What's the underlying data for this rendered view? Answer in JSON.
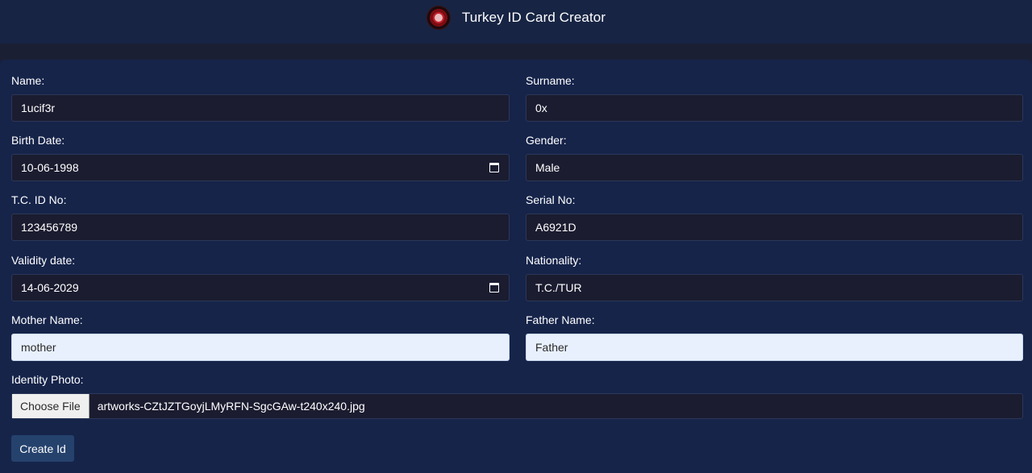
{
  "header": {
    "title": "Turkey ID Card Creator",
    "logo_icon": "emblem-icon"
  },
  "form": {
    "name": {
      "label": "Name:",
      "value": "1ucif3r"
    },
    "surname": {
      "label": "Surname:",
      "value": "0x"
    },
    "birth_date": {
      "label": "Birth Date:",
      "value": "10-06-1998"
    },
    "gender": {
      "label": "Gender:",
      "value": "Male"
    },
    "tc_id": {
      "label": "T.C. ID No:",
      "value": "123456789"
    },
    "serial_no": {
      "label": "Serial No:",
      "value": "A6921D"
    },
    "validity_date": {
      "label": "Validity date:",
      "value": "14-06-2029"
    },
    "nationality": {
      "label": "Nationality:",
      "value": "T.C./TUR"
    },
    "mother_name": {
      "label": "Mother Name:",
      "value": "mother"
    },
    "father_name": {
      "label": "Father Name:",
      "value": "Father"
    },
    "photo": {
      "label": "Identity Photo:",
      "button_label": "Choose File",
      "file_name": "artworks-CZtJZTGoyjLMyRFN-SgcGAw-t240x240.jpg"
    },
    "submit_label": "Create Id"
  },
  "colors": {
    "header_bg": "#172444",
    "panel_bg": "#16244a",
    "input_bg": "#1b1c30",
    "autofill_bg": "#e8f0fe",
    "button_bg": "#25426d"
  }
}
